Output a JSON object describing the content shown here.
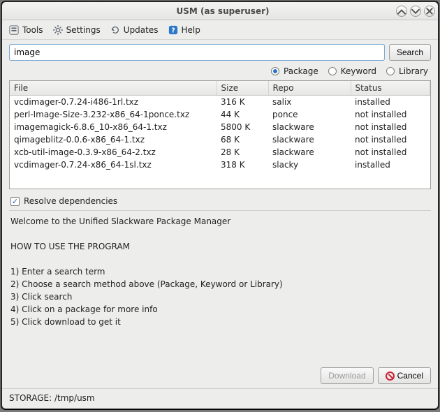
{
  "window": {
    "title": "USM (as superuser)"
  },
  "menu": {
    "tools": "Tools",
    "settings": "Settings",
    "updates": "Updates",
    "help": "Help"
  },
  "search": {
    "value": "image",
    "button": "Search"
  },
  "search_mode": {
    "package": "Package",
    "keyword": "Keyword",
    "library": "Library",
    "selected": "package"
  },
  "columns": {
    "file": "File",
    "size": "Size",
    "repo": "Repo",
    "status": "Status"
  },
  "rows": [
    {
      "file": "vcdimager-0.7.24-i486-1rl.txz",
      "size": "316 K",
      "repo": "salix",
      "status": "installed"
    },
    {
      "file": "perl-Image-Size-3.232-x86_64-1ponce.txz",
      "size": "44 K",
      "repo": "ponce",
      "status": "not installed"
    },
    {
      "file": "imagemagick-6.8.6_10-x86_64-1.txz",
      "size": "5800 K",
      "repo": "slackware",
      "status": "not installed"
    },
    {
      "file": "qimageblitz-0.0.6-x86_64-1.txz",
      "size": "68 K",
      "repo": "slackware",
      "status": "not installed"
    },
    {
      "file": "xcb-util-image-0.3.9-x86_64-2.txz",
      "size": "28 K",
      "repo": "slackware",
      "status": "not installed"
    },
    {
      "file": "vcdimager-0.7.24-x86_64-1sl.txz",
      "size": "318 K",
      "repo": "slacky",
      "status": "installed"
    }
  ],
  "resolve": {
    "label": "Resolve dependencies",
    "checked": true
  },
  "info_text": "Welcome to the Unified Slackware Package Manager\n\nHOW TO USE THE PROGRAM\n\n1) Enter a search term\n2) Choose a search method above (Package, Keyword or Library)\n3) Click search\n4) Click on a package for more info\n5) Click download to get it",
  "buttons": {
    "download": "Download",
    "cancel": "Cancel"
  },
  "status": "STORAGE: /tmp/usm"
}
